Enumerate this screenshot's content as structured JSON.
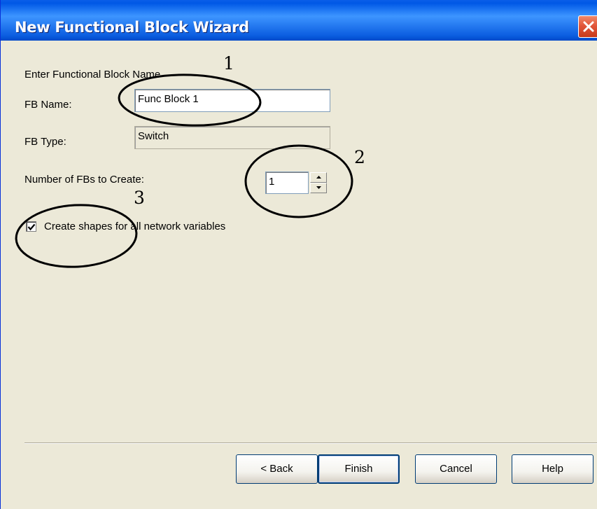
{
  "window": {
    "title": "New Functional Block Wizard",
    "titlebar_color": "#0a5ee8",
    "close_icon": "close-icon"
  },
  "form": {
    "section_label": "Enter Functional Block Name",
    "fb_name_label": "FB Name:",
    "fb_name_value": "Func Block 1",
    "fb_type_label": "FB Type:",
    "fb_type_value": "Switch",
    "count_label": "Number of FBs to Create:",
    "count_value": "1",
    "create_shapes_label": "Create shapes for all network variables",
    "create_shapes_checked": true
  },
  "annotations": {
    "one": "1",
    "two": "2",
    "three": "3"
  },
  "buttons": {
    "back": "< Back",
    "finish": "Finish",
    "cancel": "Cancel",
    "help": "Help"
  }
}
